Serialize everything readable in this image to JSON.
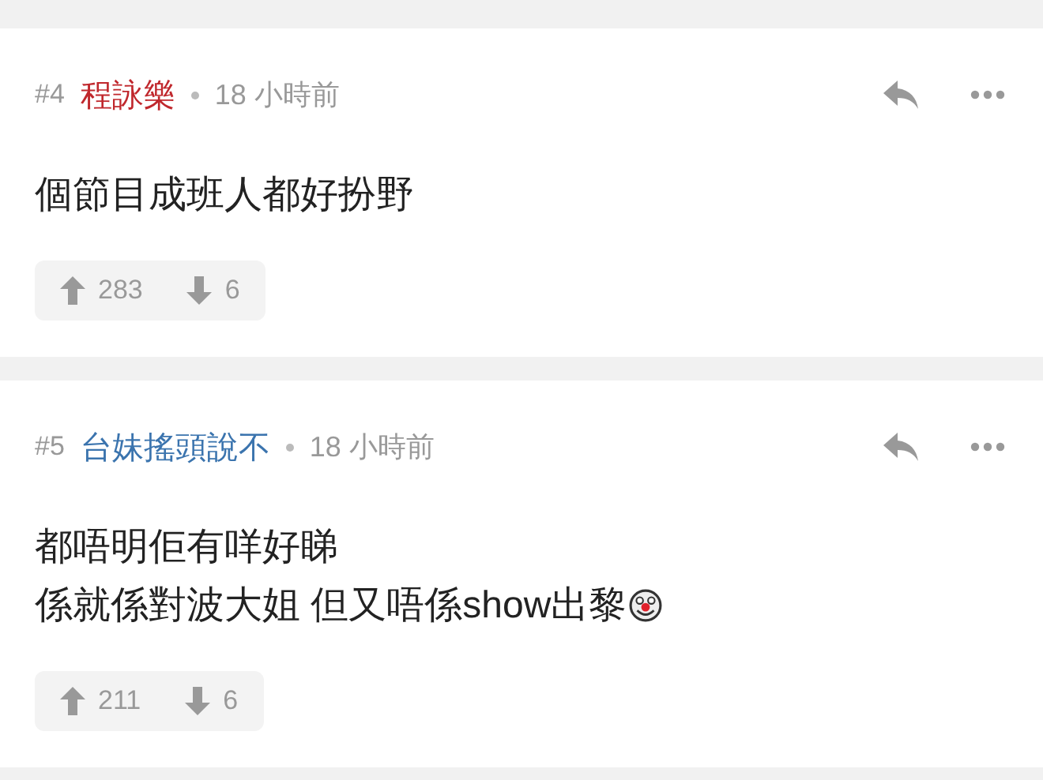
{
  "comments": [
    {
      "index": "#4",
      "author": "程詠樂",
      "color": "#c0282d",
      "time": "18 小時前",
      "body": [
        "個節目成班人都好扮野"
      ],
      "emoji": false,
      "upvotes": "283",
      "downvotes": "6"
    },
    {
      "index": "#5",
      "author": "台妹搖頭說不",
      "color": "#3b74ae",
      "time": "18 小時前",
      "body": [
        "都唔明佢有咩好睇",
        "係就係對波大姐 但又唔係show出黎"
      ],
      "emoji": true,
      "upvotes": "211",
      "downvotes": "6"
    }
  ]
}
